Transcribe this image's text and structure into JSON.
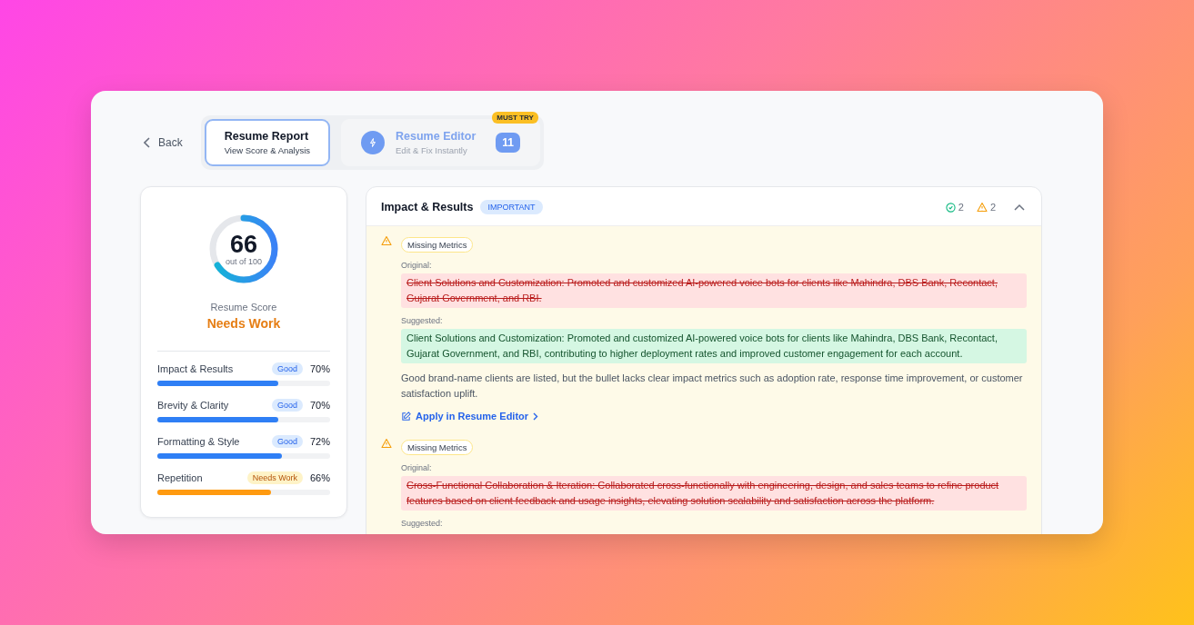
{
  "nav": {
    "back": "Back",
    "tabs": [
      {
        "title": "Resume Report",
        "subtitle": "View Score & Analysis",
        "selected": true
      },
      {
        "title": "Resume Editor",
        "subtitle": "Edit & Fix Instantly",
        "selected": false,
        "badge": "MUST TRY",
        "count": "11"
      }
    ]
  },
  "score": {
    "value": "66",
    "out_of": "out of 100",
    "level": 0.66,
    "label": "Resume Score",
    "verdict": "Needs Work",
    "categories": [
      {
        "name": "Impact & Results",
        "status": "Good",
        "kind": "good",
        "percent": "70%",
        "level": 0.7
      },
      {
        "name": "Brevity & Clarity",
        "status": "Good",
        "kind": "good",
        "percent": "70%",
        "level": 0.7
      },
      {
        "name": "Formatting & Style",
        "status": "Good",
        "kind": "good",
        "percent": "72%",
        "level": 0.72
      },
      {
        "name": "Repetition",
        "status": "Needs Work",
        "kind": "warn",
        "percent": "66%",
        "level": 0.66
      }
    ]
  },
  "section": {
    "title": "Impact & Results",
    "tag": "IMPORTANT",
    "passed": "2",
    "warnings": "2",
    "expanded": true,
    "items": [
      {
        "tag": "Missing Metrics",
        "original_label": "Original:",
        "original": "Client Solutions and Customization: Promoted and customized AI-powered voice bots for clients like Mahindra, DBS Bank, Recontact, Gujarat Government, and RBI.",
        "suggested_label": "Suggested:",
        "suggested": "Client Solutions and Customization: Promoted and customized AI-powered voice bots for clients like Mahindra, DBS Bank, Recontact, Gujarat Government, and RBI, contributing to higher deployment rates and improved customer engagement for each account.",
        "note": "Good brand-name clients are listed, but the bullet lacks clear impact metrics such as adoption rate, response time improvement, or customer satisfaction uplift.",
        "action": "Apply in Resume Editor"
      },
      {
        "tag": "Missing Metrics",
        "original_label": "Original:",
        "original": "Cross-Functional Collaboration & Iteration: Collaborated cross-functionally with engineering, design, and sales teams to refine product features based on client feedback and usage insights, elevating solution scalability and satisfaction across the platform.",
        "suggested_label": "Suggested:"
      }
    ]
  }
}
